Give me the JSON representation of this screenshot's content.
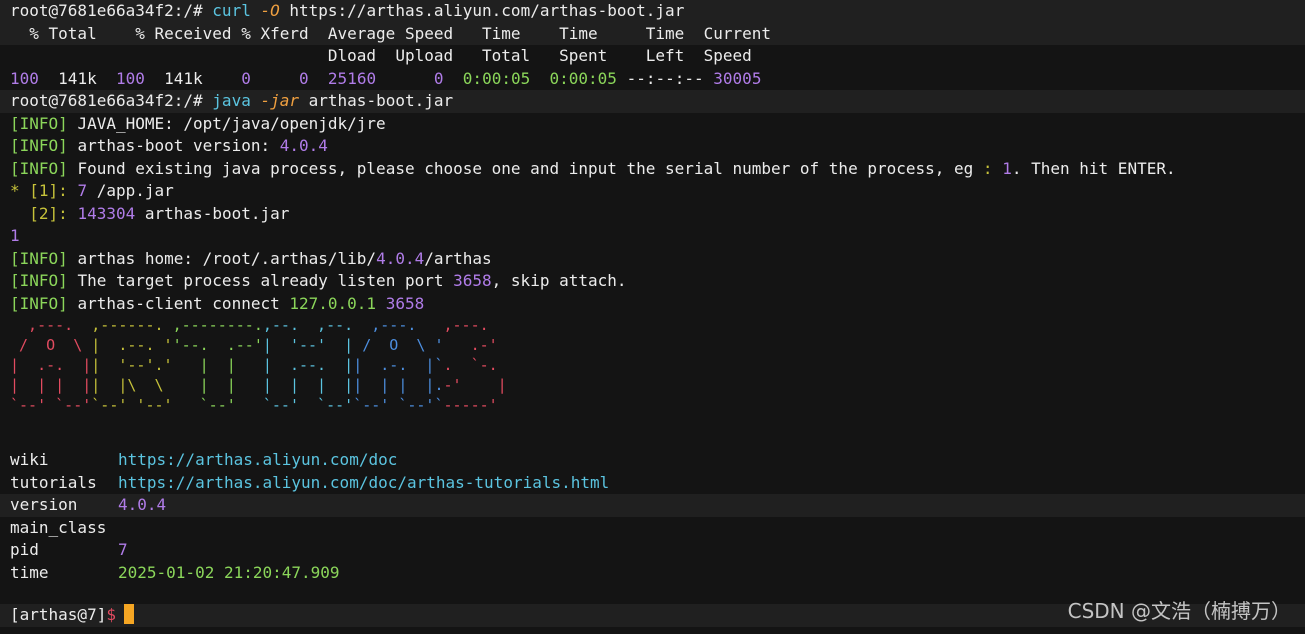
{
  "prompt1": {
    "user": "root@7681e66a34f2:/#",
    "cmd": "curl",
    "flag": "-O",
    "arg": "https://arthas.aliyun.com/arthas-boot.jar"
  },
  "curl": {
    "header1": "  % Total    % Received % Xferd  Average Speed   Time    Time     Time  Current",
    "header2": "                                 Dload  Upload   Total   Spent    Left  Speed",
    "row": [
      "100",
      "141k",
      "100",
      "141k",
      "0",
      "0",
      "25160",
      "0",
      "0:00:05",
      "0:00:05",
      "--:--:--",
      "30005"
    ]
  },
  "prompt2": {
    "user": "root@7681e66a34f2:/#",
    "cmd": "java",
    "flag": "-jar",
    "arg": "arthas-boot.jar"
  },
  "info_tag": "[INFO]",
  "info": {
    "java_home_label": "JAVA_HOME: /opt/java/openjdk/jre",
    "version_label": "arthas-boot version: ",
    "version_value": "4.0.4",
    "found_text": "Found existing java process, please choose one and input the serial number of the process, eg ",
    "found_colon": ":",
    "found_num": "1",
    "found_tail": ". Then hit ENTER."
  },
  "processes": [
    {
      "marker": "*",
      "index": "[1]:",
      "pid": "7",
      "name": "/app.jar"
    },
    {
      "marker": " ",
      "index": "[2]:",
      "pid": "143304",
      "name": "arthas-boot.jar"
    }
  ],
  "selection": "1",
  "after": {
    "home_label": "arthas home: /root/.arthas/lib/",
    "home_ver": "4.0.4",
    "home_tail": "/arthas",
    "target_label": "The target process already listen port ",
    "target_port": "3658",
    "target_tail": ", skip attach.",
    "client_label": "arthas-client connect ",
    "client_ip": "127.0.0.1",
    "client_port": "3658"
  },
  "art": {
    "colors": [
      "#e24b60",
      "#c6c23a",
      "#8bd65a",
      "#5bc4e0",
      "#4d8fe0"
    ],
    "lines": [
      "  ,---.  ,------. ,--------.,--.  ,--.  ,---.   ,---.  ",
      " /  O  \\ |  .--. ''--.  .--'|  '--'  | /  O  \\ '   .-' ",
      "|  .-.  ||  '--'.'   |  |   |  .--.  ||  .-.  |`.  `-. ",
      "|  | |  ||  |\\  \\    |  |   |  |  |  ||  | |  |.-'    |",
      "`--' `--'`--' '--'   `--'   `--'  `--'`--' `--'`-----' "
    ]
  },
  "info_table": [
    {
      "key": "wiki",
      "value": "https://arthas.aliyun.com/doc",
      "color": "c"
    },
    {
      "key": "tutorials",
      "value": "https://arthas.aliyun.com/doc/arthas-tutorials.html",
      "color": "c"
    },
    {
      "key": "version",
      "value": "4.0.4",
      "color": "p"
    },
    {
      "key": "main_class",
      "value": "",
      "color": "p"
    },
    {
      "key": "pid",
      "value": "7",
      "color": "p"
    },
    {
      "key": "time",
      "value": "2025-01-02 21:20:47.909",
      "color": "g"
    }
  ],
  "prompt3": {
    "label": "[arthas@7]",
    "symbol": "$"
  },
  "watermark": "CSDN @文浩（楠搏万）"
}
